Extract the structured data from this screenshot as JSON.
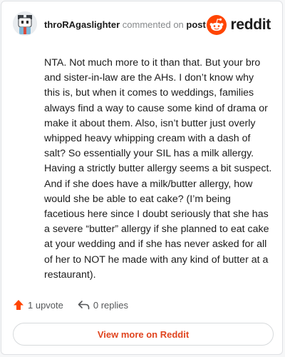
{
  "header": {
    "username": "throRAgaslighter",
    "action_text": "commented on",
    "post_link": "post"
  },
  "brand": {
    "logo_icon": "reddit-alien-icon",
    "wordmark": "reddit",
    "accent_color": "#ff4500"
  },
  "comment": {
    "text": "NTA. Not much more to it than that. But your bro and sister-in-law are the AHs. I don’t know why this is, but when it comes to weddings, families always find a way to cause some kind of drama or make it about them. Also, isn’t butter just overly whipped heavy whipping cream with a dash of salt? So essentially your SIL has a milk allergy. Having a strictly butter allergy seems a bit suspect. And if she does have a milk/butter allergy, how would she be able to eat cake? (I’m being facetious here since I doubt seriously that she has a severe “butter” allergy if she planned to eat cake at your wedding and if she has never asked for all of her to NOT he made with any kind of butter at a restaurant)."
  },
  "footer": {
    "upvote_icon": "upvote-arrow-icon",
    "upvote_label": "1 upvote",
    "reply_icon": "reply-arrow-icon",
    "replies_label": "0 replies"
  },
  "cta": {
    "label": "View more on Reddit"
  }
}
